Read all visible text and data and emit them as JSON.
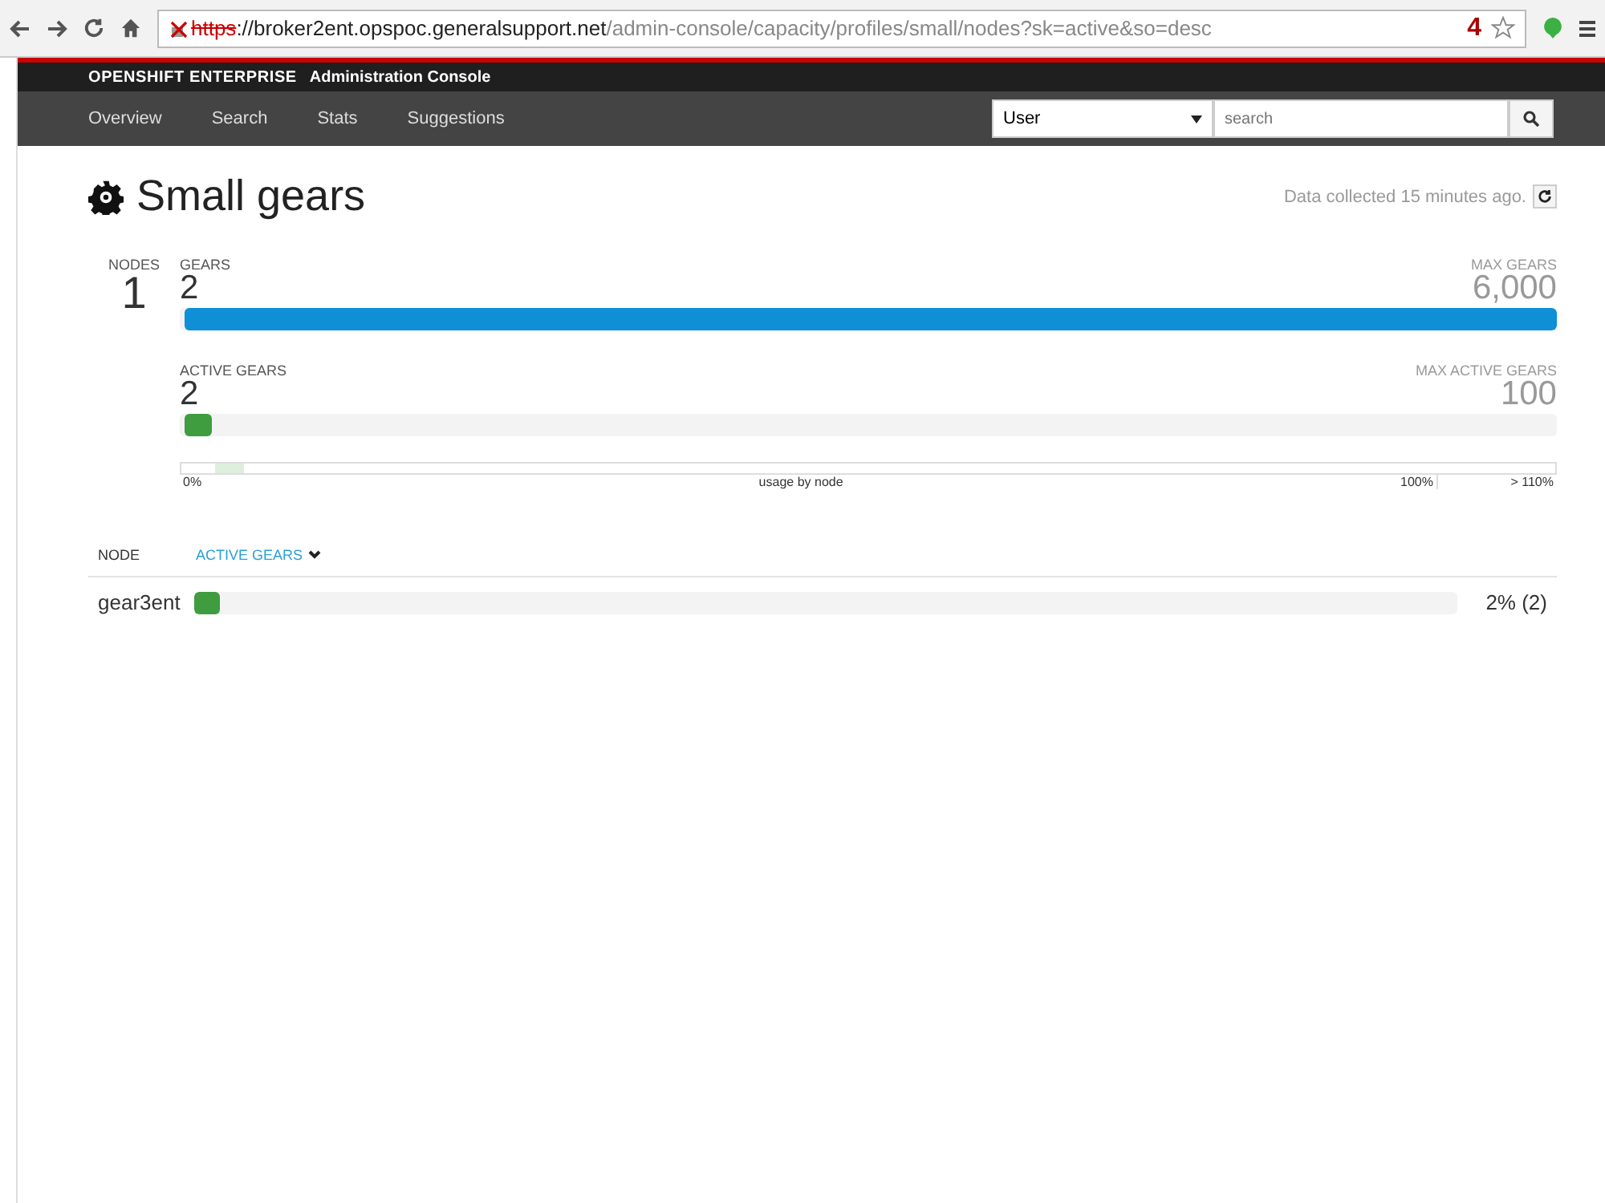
{
  "browser": {
    "url_scheme": "https",
    "url_host": "://broker2ent.opspoc.generalsupport.net",
    "url_path": "/admin-console/capacity/profiles/small/nodes?sk=active&so=desc",
    "badge": "4"
  },
  "header": {
    "brand": "OPENSHIFT ENTERPRISE",
    "subtitle": "Administration Console"
  },
  "nav": {
    "items": [
      {
        "label": "Overview"
      },
      {
        "label": "Search"
      },
      {
        "label": "Stats"
      },
      {
        "label": "Suggestions"
      }
    ],
    "search_type": "User",
    "search": {
      "placeholder": "search"
    }
  },
  "page": {
    "title": "Small gears",
    "collected": "Data collected 15 minutes ago."
  },
  "summary": {
    "nodes_label": "NODES",
    "nodes": "1",
    "meters": [
      {
        "label": "GEARS",
        "value": "2",
        "max_label": "MAX GEARS",
        "max": "6,000",
        "level": 1,
        "color": "#0f8fd6"
      },
      {
        "label": "ACTIVE GEARS",
        "value": "2",
        "max_label": "MAX ACTIVE GEARS",
        "max": "100",
        "level": 0.02,
        "color": "#3f9c3f"
      }
    ],
    "usage": {
      "level": 0.02,
      "start": "0%",
      "middle": "usage by node",
      "full": "100%",
      "over": "> 110%"
    }
  },
  "table": {
    "columns": [
      {
        "label": "NODE",
        "selected": false
      },
      {
        "label": "ACTIVE GEARS",
        "selected": true
      }
    ],
    "rows": [
      {
        "node": "gear3ent",
        "level": 0.02,
        "reading": "2% (2)"
      }
    ]
  }
}
